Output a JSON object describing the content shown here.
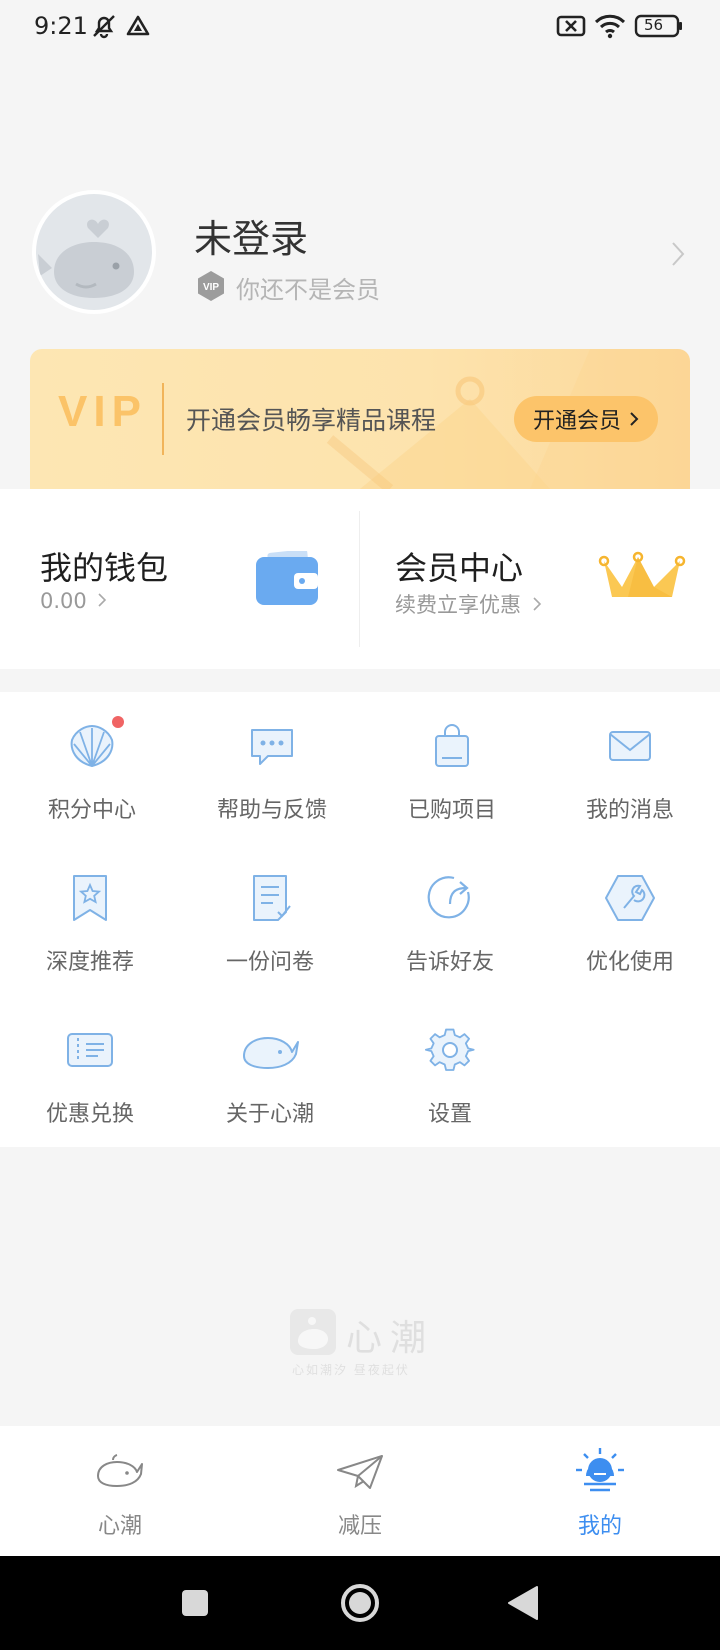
{
  "status_bar": {
    "time": "9:21",
    "battery": "56"
  },
  "profile": {
    "name": "未登录",
    "vip_badge": "VIP",
    "subtitle": "你还不是会员"
  },
  "vip_banner": {
    "logo": "VIP",
    "text": "开通会员畅享精品课程",
    "button": "开通会员"
  },
  "wallet": {
    "title": "我的钱包",
    "value": "0.00"
  },
  "member_center": {
    "title": "会员中心",
    "subtitle": "续费立享优惠"
  },
  "grid": {
    "items": [
      {
        "label": "积分中心",
        "icon": "shell-icon"
      },
      {
        "label": "帮助与反馈",
        "icon": "chat-bubble-icon"
      },
      {
        "label": "已购项目",
        "icon": "shopping-bag-icon"
      },
      {
        "label": "我的消息",
        "icon": "envelope-icon"
      },
      {
        "label": "深度推荐",
        "icon": "bookmark-star-icon"
      },
      {
        "label": "一份问卷",
        "icon": "questionnaire-icon"
      },
      {
        "label": "告诉好友",
        "icon": "share-icon"
      },
      {
        "label": "优化使用",
        "icon": "wrench-icon"
      },
      {
        "label": "优惠兑换",
        "icon": "coupon-icon"
      },
      {
        "label": "关于心潮",
        "icon": "whale-icon"
      },
      {
        "label": "设置",
        "icon": "gear-icon"
      }
    ]
  },
  "brand": {
    "name": "心潮",
    "slogan": "心如潮汐 昼夜起伏"
  },
  "bottom_nav": {
    "items": [
      {
        "label": "心潮",
        "icon": "whale-icon"
      },
      {
        "label": "减压",
        "icon": "paper-plane-icon"
      },
      {
        "label": "我的",
        "icon": "sunrise-icon",
        "active": true
      }
    ]
  },
  "colors": {
    "accent": "#3d8ef0",
    "vip_gold": "#fcc46a",
    "icon_blue": "#7fb2e6"
  }
}
